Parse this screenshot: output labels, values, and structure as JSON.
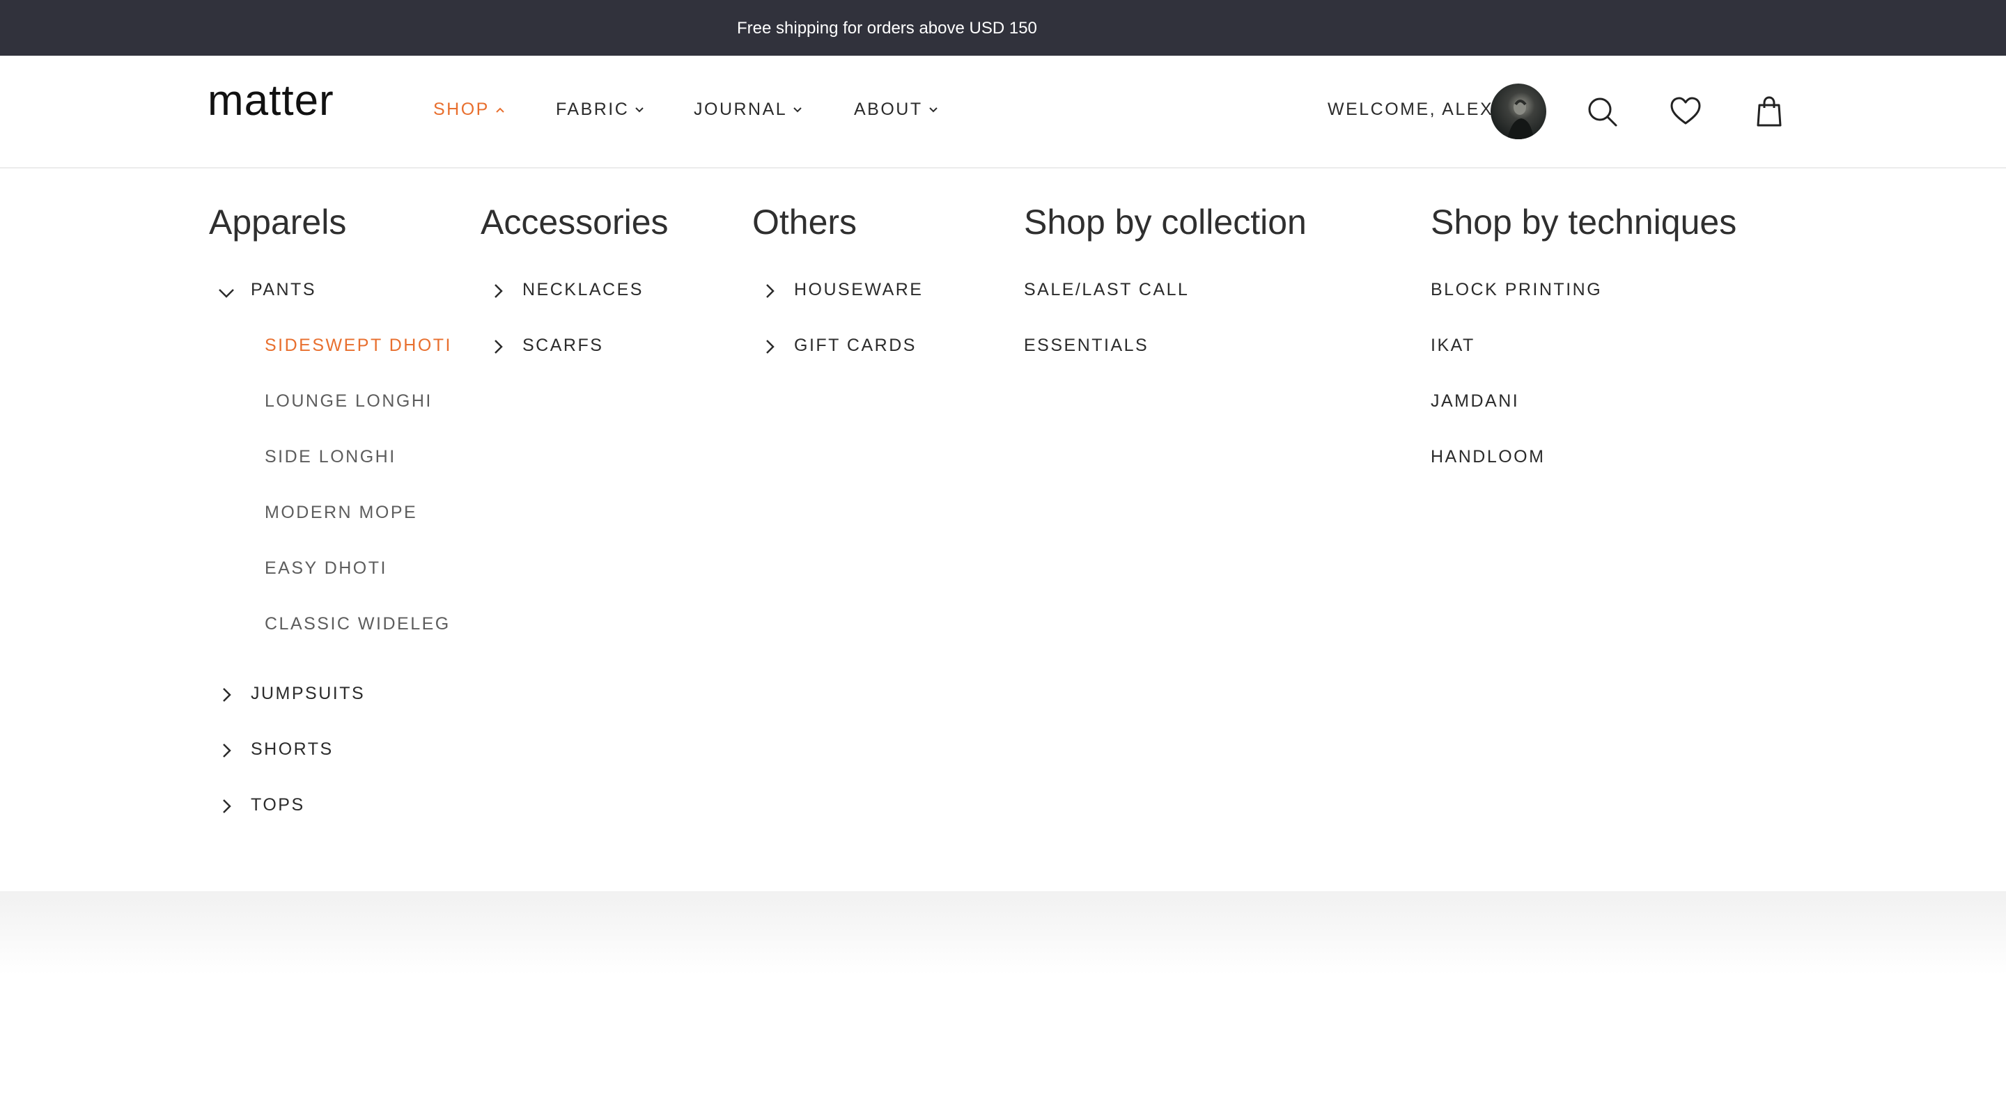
{
  "announcement": "Free shipping for orders above USD 150",
  "logo": "matter",
  "nav": {
    "items": [
      {
        "label": "SHOP",
        "state": "open"
      },
      {
        "label": "FABRIC",
        "state": "closed"
      },
      {
        "label": "JOURNAL",
        "state": "closed"
      },
      {
        "label": "ABOUT",
        "state": "closed"
      }
    ]
  },
  "account": {
    "welcome": "WELCOME, ALEX"
  },
  "icons": [
    "search-icon",
    "heart-icon",
    "shopping-bag-icon"
  ],
  "colors": {
    "accent": "#e86f2e",
    "topbar": "#31323c",
    "text": "#2b2b2b"
  },
  "menu": {
    "apparels": {
      "title": "Apparels",
      "pants": {
        "label": "PANTS",
        "expanded": true,
        "items": [
          "SIDESWEPT DHOTI",
          "LOUNGE LONGHI",
          "SIDE LONGHI",
          "MODERN MOPE",
          "EASY DHOTI",
          "CLASSIC WIDELEG"
        ],
        "selected": "SIDESWEPT DHOTI"
      },
      "others": [
        "JUMPSUITS",
        "SHORTS",
        "TOPS"
      ]
    },
    "accessories": {
      "title": "Accessories",
      "items": [
        "NECKLACES",
        "SCARFS"
      ]
    },
    "others": {
      "title": "Others",
      "items": [
        "HOUSEWARE",
        "GIFT CARDS"
      ]
    },
    "collection": {
      "title": "Shop by collection",
      "items": [
        "SALE/LAST CALL",
        "ESSENTIALS"
      ]
    },
    "techniques": {
      "title": "Shop by techniques",
      "items": [
        "BLOCK PRINTING",
        "IKAT",
        "JAMDANI",
        "HANDLOOM"
      ]
    }
  }
}
